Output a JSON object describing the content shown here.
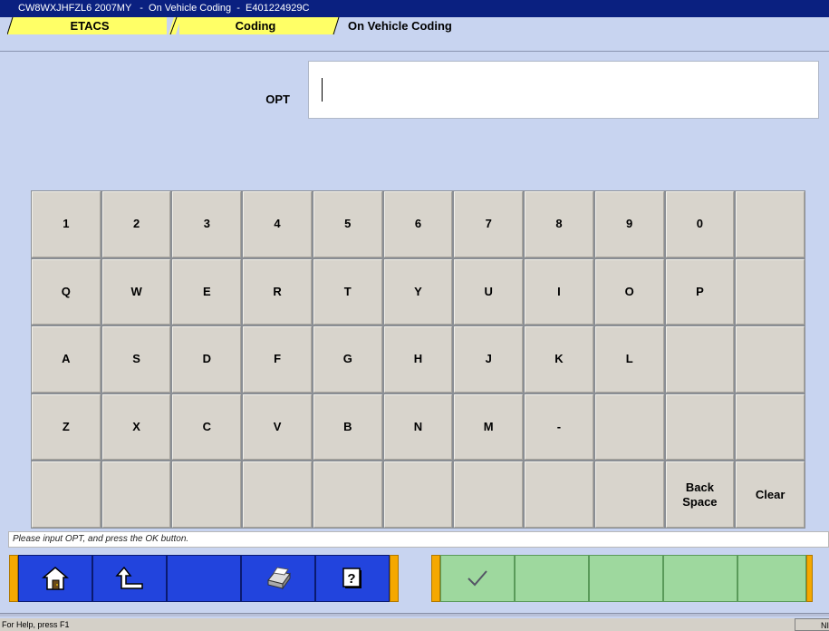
{
  "window": {
    "title": "CW8WXJHFZL6 2007MY   -  On Vehicle Coding  -  E401224929C"
  },
  "breadcrumbs": [
    {
      "label": "ETACS"
    },
    {
      "label": "Coding"
    },
    {
      "label": "On Vehicle Coding"
    }
  ],
  "form": {
    "opt_label": "OPT",
    "opt_value": ""
  },
  "keypad": {
    "rows": [
      [
        "1",
        "2",
        "3",
        "4",
        "5",
        "6",
        "7",
        "8",
        "9",
        "0",
        ""
      ],
      [
        "Q",
        "W",
        "E",
        "R",
        "T",
        "Y",
        "U",
        "I",
        "O",
        "P",
        ""
      ],
      [
        "A",
        "S",
        "D",
        "F",
        "G",
        "H",
        "J",
        "K",
        "L",
        "",
        ""
      ],
      [
        "Z",
        "X",
        "C",
        "V",
        "B",
        "N",
        "M",
        "-",
        "",
        "",
        ""
      ],
      [
        "",
        "",
        "",
        "",
        "",
        "",
        "",
        "",
        "",
        "Back\nSpace",
        "Clear"
      ]
    ]
  },
  "status_message": "Please input OPT, and press the OK button.",
  "toolbar": {
    "left_buttons": [
      "home-icon",
      "back-arrow-icon",
      "",
      "printer-icon",
      "help-icon"
    ],
    "right_buttons": [
      "checkmark-icon",
      "",
      "",
      "",
      ""
    ]
  },
  "app_status": {
    "help_text": "For Help, press F1",
    "indicator": "NI"
  },
  "colors": {
    "background": "#c8d4f0",
    "titlebar": "#0a2080",
    "crumb_active": "#ffff66",
    "toolbar_blue": "#2244dd",
    "toolbar_green": "#9ed89e",
    "toolbar_edge": "#f5a800"
  }
}
